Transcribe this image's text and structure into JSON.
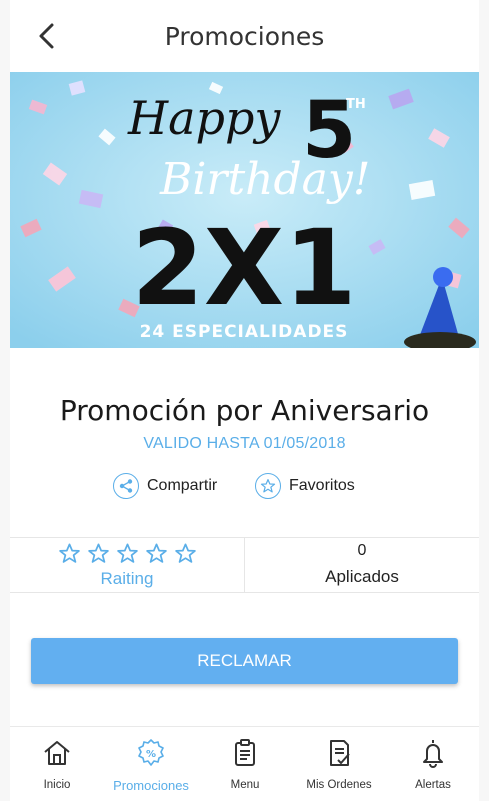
{
  "header": {
    "title": "Promociones",
    "back_icon": "chevron-left-icon"
  },
  "banner": {
    "line1": "Happy",
    "number": "5",
    "superscript": "TH",
    "line2": "Birthday!",
    "offer": "2X1",
    "subtitle": "24 ESPECIALIDADES",
    "background_color": "#9fd7ef"
  },
  "promo": {
    "title": "Promoción por Aniversario",
    "valid_until": "VALIDO HASTA 01/05/2018"
  },
  "actions": {
    "share_label": "Compartir",
    "favorite_label": "Favoritos"
  },
  "stats": {
    "rating_label": "Raiting",
    "rating_value": 0,
    "rating_max": 5,
    "applied_count": "0",
    "applied_label": "Aplicados"
  },
  "claim_button": {
    "label": "RECLAMAR",
    "color": "#62aff0"
  },
  "tabbar": {
    "items": [
      {
        "label": "Inicio",
        "icon": "home-icon"
      },
      {
        "label": "Promociones",
        "icon": "promo-percent-icon",
        "active": true
      },
      {
        "label": "Menu",
        "icon": "clipboard-icon"
      },
      {
        "label": "Mis Ordenes",
        "icon": "checklist-icon"
      },
      {
        "label": "Alertas",
        "icon": "bell-icon"
      }
    ]
  },
  "accent_color": "#5aaee8"
}
